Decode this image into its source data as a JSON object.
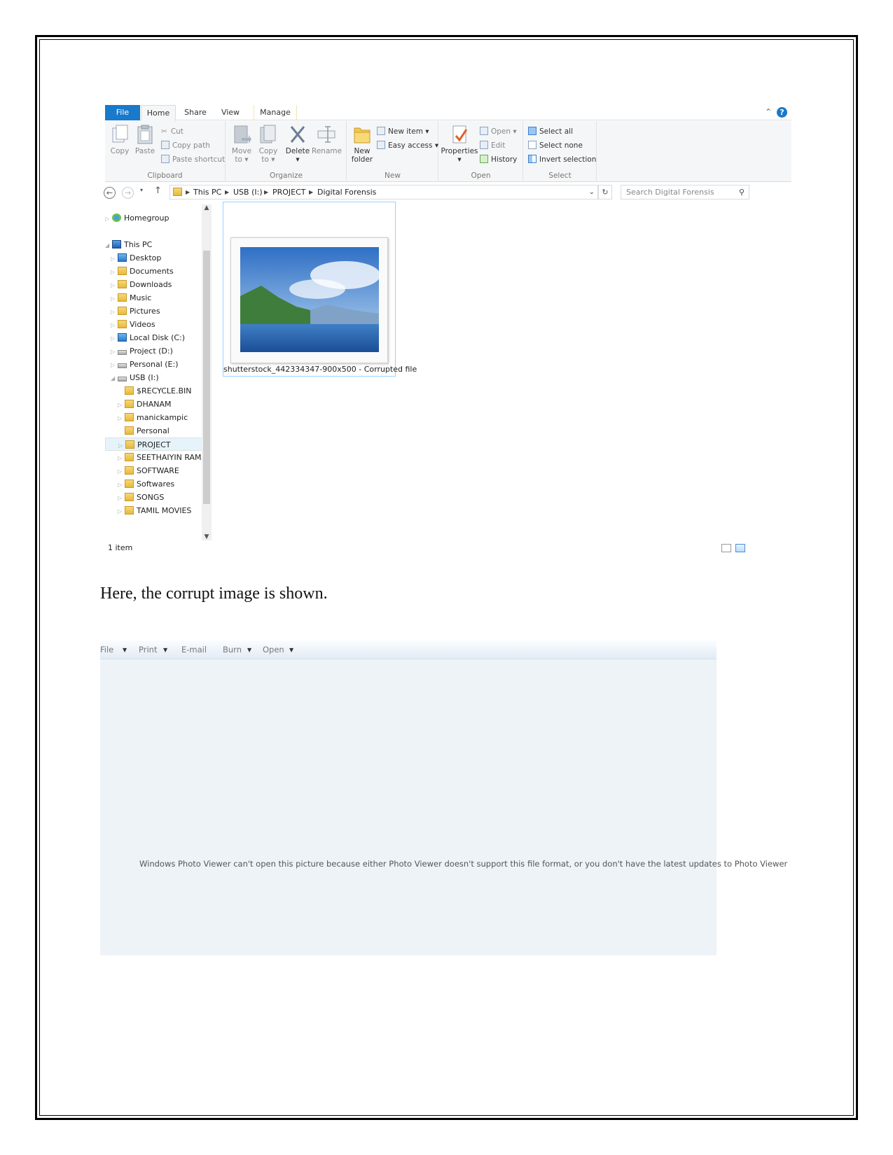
{
  "explorer": {
    "tabs": {
      "file": "File",
      "home": "Home",
      "share": "Share",
      "view": "View",
      "manage": "Manage"
    },
    "ribbon": {
      "clipboard": {
        "label": "Clipboard",
        "copy": "Copy",
        "paste": "Paste",
        "cut": "Cut",
        "copy_path": "Copy path",
        "paste_shortcut": "Paste shortcut"
      },
      "organize": {
        "label": "Organize",
        "move_to": "Move to",
        "copy_to": "Copy to",
        "delete": "Delete",
        "rename": "Rename"
      },
      "new": {
        "label": "New",
        "new_folder": "New folder",
        "new_item": "New item",
        "easy_access": "Easy access"
      },
      "open": {
        "label": "Open",
        "properties": "Properties",
        "open": "Open",
        "edit": "Edit",
        "history": "History"
      },
      "select": {
        "label": "Select",
        "select_all": "Select all",
        "select_none": "Select none",
        "invert_selection": "Invert selection"
      }
    },
    "address": {
      "crumbs": [
        "This PC",
        "USB (I:)",
        "PROJECT",
        "Digital Forensis"
      ],
      "search_placeholder": "Search Digital Forensis"
    },
    "nav": {
      "homegroup": "Homegroup",
      "this_pc": "This PC",
      "pc_items": [
        "Desktop",
        "Documents",
        "Downloads",
        "Music",
        "Pictures",
        "Videos",
        "Local Disk (C:)",
        "Project (D:)",
        "Personal (E:)",
        "USB (I:)"
      ],
      "usb_items": [
        "$RECYCLE.BIN",
        "DHANAM",
        "manickampic",
        "Personal",
        "PROJECT",
        "SEETHAIYIN RAMA",
        "SOFTWARE",
        "Softwares",
        "SONGS",
        "TAMIL MOVIES"
      ]
    },
    "file": {
      "name": "shutterstock_442334347-900x500 - Corrupted file"
    },
    "status": {
      "item_count": "1 item"
    }
  },
  "caption": "Here, the corrupt image is shown.",
  "viewer": {
    "toolbar": {
      "file": "File",
      "print": "Print",
      "email": "E-mail",
      "burn": "Burn",
      "open": "Open"
    },
    "message": "Windows Photo Viewer can't open this picture because either Photo Viewer doesn't support this file format, or you don't have the latest updates to Photo Viewer"
  }
}
